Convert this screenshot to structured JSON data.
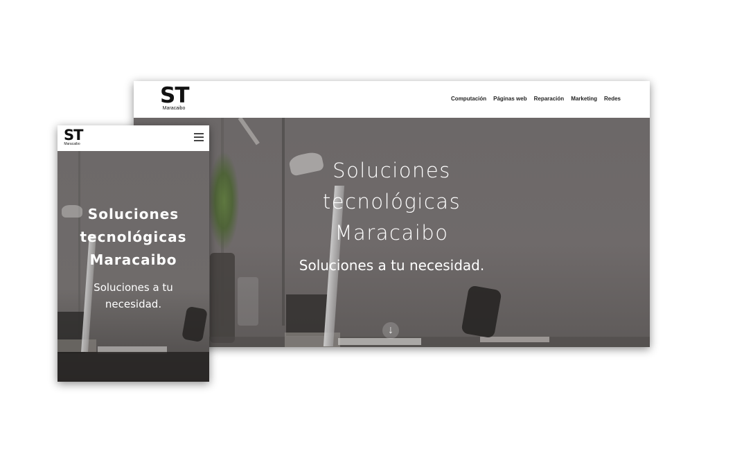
{
  "brand": {
    "logo_mark": "ST",
    "logo_sub": "Maracaibo"
  },
  "desktop": {
    "nav": {
      "items": [
        {
          "label": "Computación"
        },
        {
          "label": "Páginas web"
        },
        {
          "label": "Reparación"
        },
        {
          "label": "Marketing"
        },
        {
          "label": "Redes"
        }
      ]
    },
    "hero": {
      "title_line1": "Soluciones",
      "title_line2": "tecnológicas",
      "title_line3": "Maracaibo",
      "subtitle": "Soluciones a tu necesidad.",
      "scroll_icon": "arrow-down-icon"
    }
  },
  "mobile": {
    "menu_icon": "hamburger-menu-icon",
    "hero": {
      "title_line1": "Soluciones",
      "title_line2": "tecnológicas",
      "title_line3": "Maracaibo",
      "subtitle_line1": "Soluciones a tu",
      "subtitle_line2": "necesidad."
    }
  },
  "colors": {
    "navbar_bg": "#ffffff",
    "hero_overlay": "#6f6b6b",
    "hero_text": "#ffffff",
    "nav_text": "#222222"
  }
}
